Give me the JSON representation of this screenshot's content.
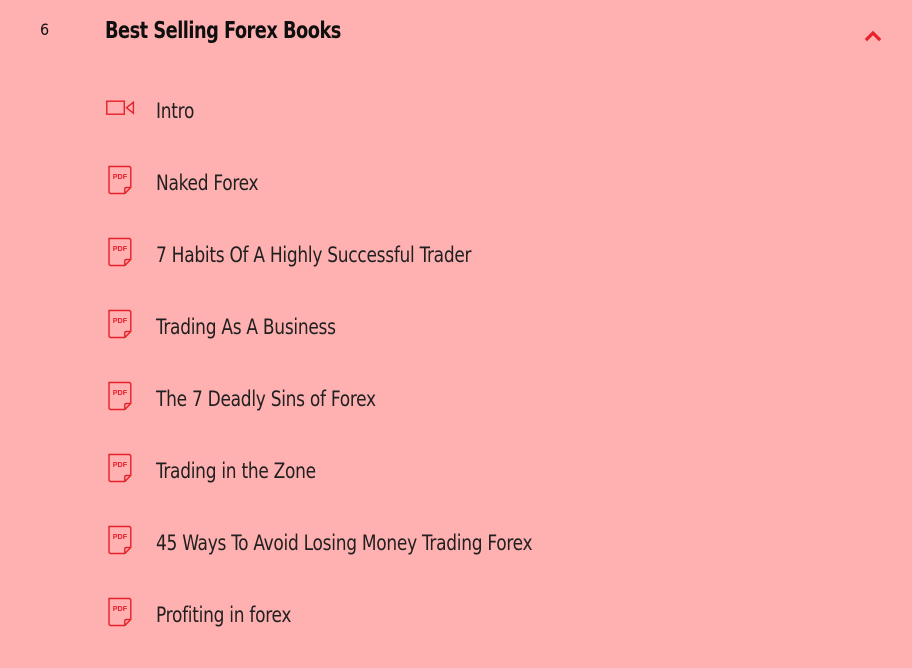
{
  "section": {
    "number": "6",
    "title": "Best Selling Forex Books",
    "toggle_icon": "chevron-up-icon",
    "accent_color": "#e8202a",
    "background_color": "#ffb0b0"
  },
  "lessons": [
    {
      "title": "Intro",
      "icon": "video-icon"
    },
    {
      "title": "Naked Forex",
      "icon": "pdf-icon",
      "icon_text": "PDF"
    },
    {
      "title": "7 Habits Of A Highly Successful Trader",
      "icon": "pdf-icon",
      "icon_text": "PDF"
    },
    {
      "title": "Trading As A Business",
      "icon": "pdf-icon",
      "icon_text": "PDF"
    },
    {
      "title": "The 7 Deadly Sins of Forex",
      "icon": "pdf-icon",
      "icon_text": "PDF"
    },
    {
      "title": "Trading in the Zone",
      "icon": "pdf-icon",
      "icon_text": "PDF"
    },
    {
      "title": "45 Ways To Avoid Losing Money Trading Forex",
      "icon": "pdf-icon",
      "icon_text": "PDF"
    },
    {
      "title": "Profiting in forex",
      "icon": "pdf-icon",
      "icon_text": "PDF"
    }
  ]
}
